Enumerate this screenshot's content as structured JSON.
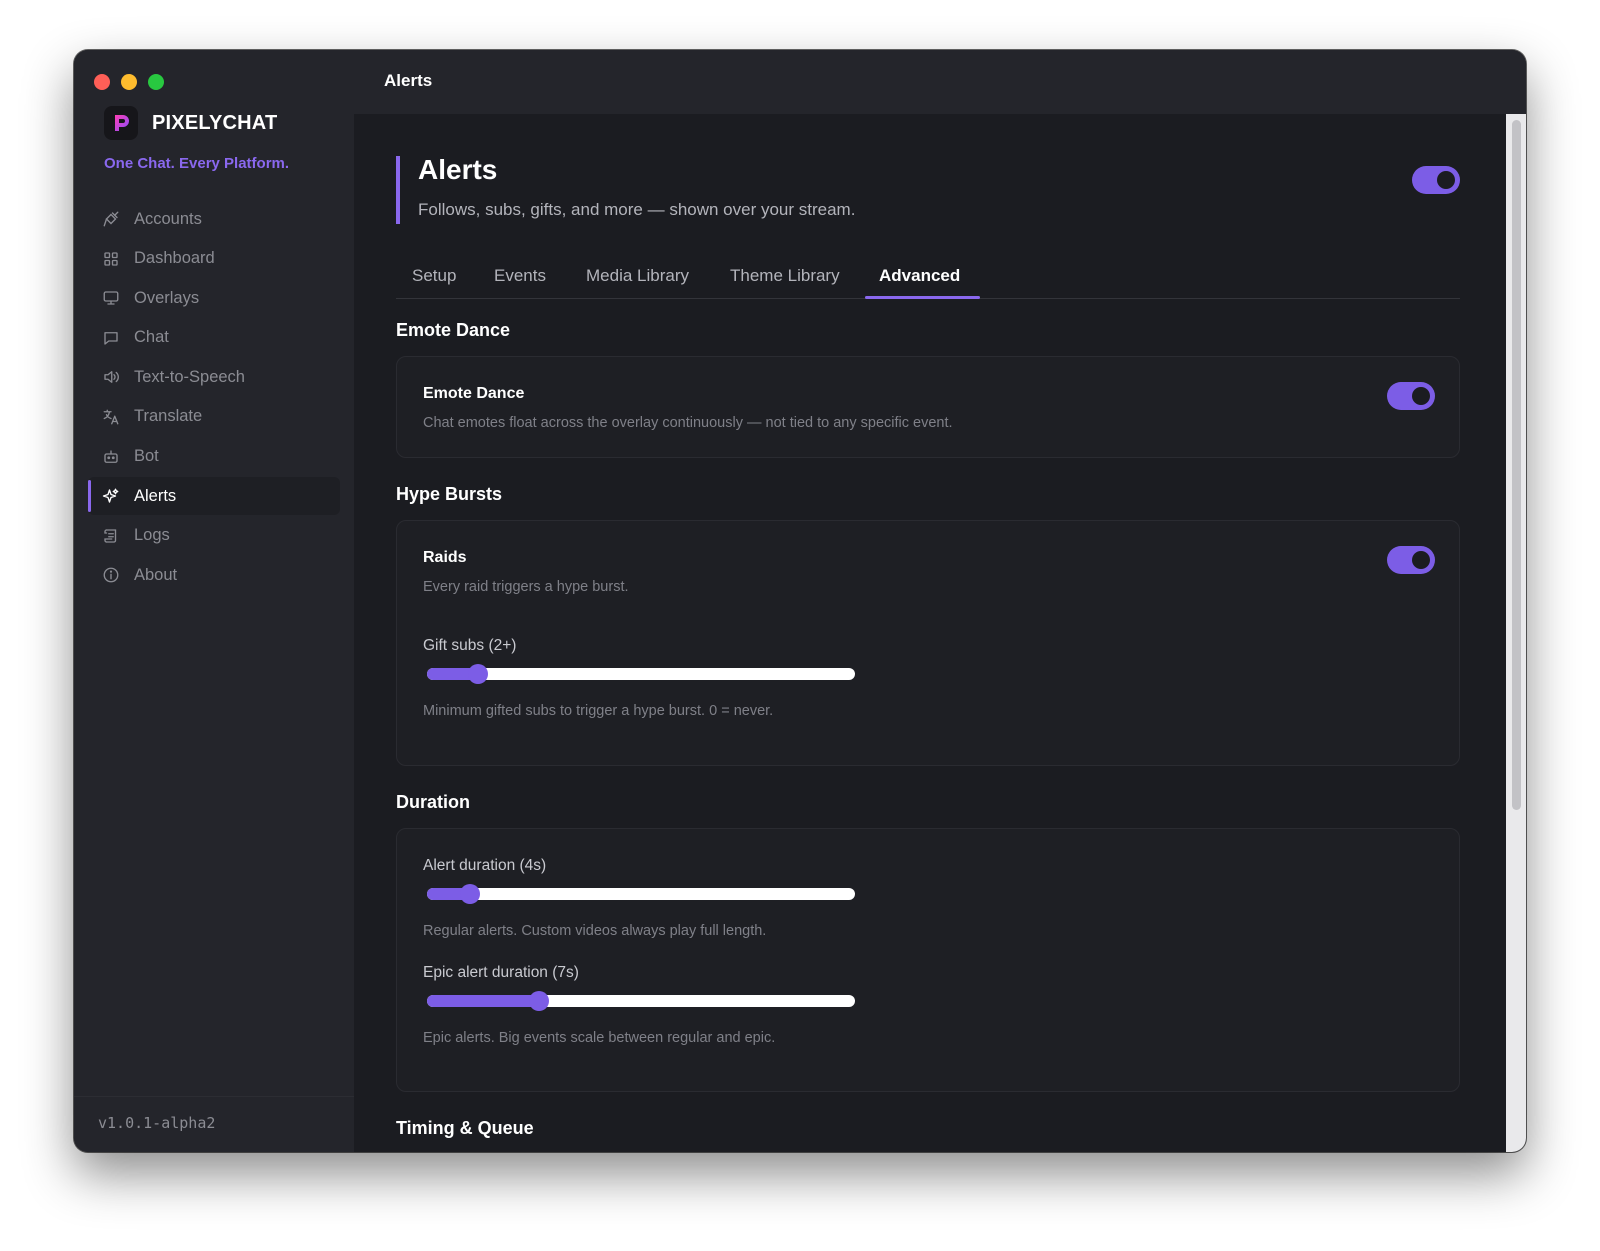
{
  "app": {
    "brand_name": "PIXELYCHAT",
    "tagline": "One Chat. Every Platform.",
    "version": "v1.0.1-alpha2",
    "accent_color": "#8a68ee"
  },
  "window": {
    "title": "Alerts"
  },
  "sidebar": {
    "items": [
      {
        "label": "Accounts",
        "icon": "plug-icon",
        "active": false
      },
      {
        "label": "Dashboard",
        "icon": "grid-icon",
        "active": false
      },
      {
        "label": "Overlays",
        "icon": "monitor-icon",
        "active": false
      },
      {
        "label": "Chat",
        "icon": "chat-bubble-icon",
        "active": false
      },
      {
        "label": "Text-to-Speech",
        "icon": "speaker-icon",
        "active": false
      },
      {
        "label": "Translate",
        "icon": "translate-icon",
        "active": false
      },
      {
        "label": "Bot",
        "icon": "bot-icon",
        "active": false
      },
      {
        "label": "Alerts",
        "icon": "sparkles-icon",
        "active": true
      },
      {
        "label": "Logs",
        "icon": "scroll-icon",
        "active": false
      },
      {
        "label": "About",
        "icon": "info-icon",
        "active": false
      }
    ]
  },
  "header": {
    "title": "Alerts",
    "subtitle": "Follows, subs, gifts, and more — shown over your stream.",
    "enabled": true
  },
  "tabs": [
    {
      "label": "Setup",
      "active": false
    },
    {
      "label": "Events",
      "active": false
    },
    {
      "label": "Media Library",
      "active": false
    },
    {
      "label": "Theme Library",
      "active": false
    },
    {
      "label": "Advanced",
      "active": true
    }
  ],
  "sections": {
    "emote_dance": {
      "title": "Emote Dance",
      "label": "Emote Dance",
      "desc": "Chat emotes float across the overlay continuously — not tied to any specific event.",
      "enabled": true
    },
    "hype_bursts": {
      "title": "Hype Bursts",
      "raids_label": "Raids",
      "raids_desc": "Every raid triggers a hype burst.",
      "raids_enabled": true,
      "gift_label": "Gift subs (2+)",
      "gift_desc": "Minimum gifted subs to trigger a hype burst. 0 = never.",
      "gift_value_fraction": 0.1
    },
    "duration": {
      "title": "Duration",
      "alert_label": "Alert duration (4s)",
      "alert_desc": "Regular alerts. Custom videos always play full length.",
      "alert_value_fraction": 0.08,
      "epic_label": "Epic alert duration (7s)",
      "epic_desc": "Epic alerts. Big events scale between regular and epic.",
      "epic_value_fraction": 0.25
    },
    "timing": {
      "title": "Timing & Queue"
    }
  }
}
